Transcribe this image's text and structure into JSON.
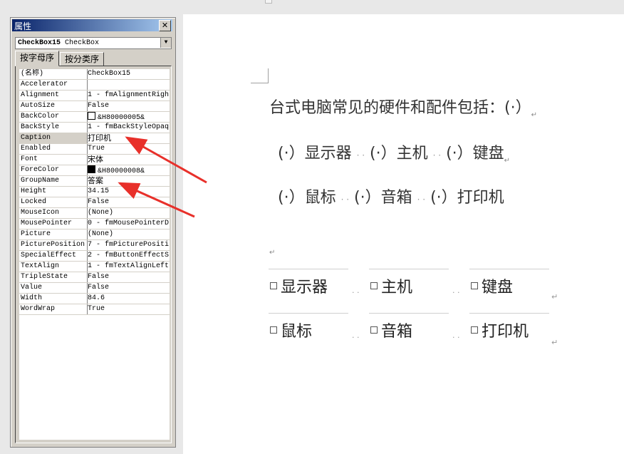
{
  "panel": {
    "title": "属性",
    "close": "✕",
    "object_selector": "CheckBox15 CheckBox",
    "tabs": [
      "按字母序",
      "按分类序"
    ],
    "properties": [
      {
        "name": "(名称)",
        "value": "CheckBox15"
      },
      {
        "name": "Accelerator",
        "value": ""
      },
      {
        "name": "Alignment",
        "value": "1 - fmAlignmentRigh"
      },
      {
        "name": "AutoSize",
        "value": "False"
      },
      {
        "name": "BackColor",
        "value": "&H80000005&"
      },
      {
        "name": "BackStyle",
        "value": "1 - fmBackStyleOpaq"
      },
      {
        "name": "Caption",
        "value": "打印机"
      },
      {
        "name": "Enabled",
        "value": "True"
      },
      {
        "name": "Font",
        "value": "宋体"
      },
      {
        "name": "ForeColor",
        "value": "&H80000008&"
      },
      {
        "name": "GroupName",
        "value": "答案"
      },
      {
        "name": "Height",
        "value": "34.15"
      },
      {
        "name": "Locked",
        "value": "False"
      },
      {
        "name": "MouseIcon",
        "value": "(None)"
      },
      {
        "name": "MousePointer",
        "value": "0 - fmMousePointerD"
      },
      {
        "name": "Picture",
        "value": "(None)"
      },
      {
        "name": "PicturePosition",
        "value": "7 - fmPicturePositi"
      },
      {
        "name": "SpecialEffect",
        "value": "2 - fmButtonEffectS"
      },
      {
        "name": "TextAlign",
        "value": "1 - fmTextAlignLeft"
      },
      {
        "name": "TripleState",
        "value": "False"
      },
      {
        "name": "Value",
        "value": "False"
      },
      {
        "name": "Width",
        "value": "84.6"
      },
      {
        "name": "WordWrap",
        "value": "True"
      }
    ],
    "colors": {
      "backcolor_swatch": "#ffffff",
      "forecolor_swatch": "#000000",
      "selected_row": "#d4d0c8"
    }
  },
  "doc": {
    "question": "台式电脑常见的硬件和配件包括：(·）",
    "line2": "(·）显示器",
    "line2b": "(·）主机",
    "line2c": "(·）键盘",
    "line3": "(·）鼠标",
    "line3b": "(·）音箱",
    "line3c": "(·）打印机",
    "checkboxes": [
      "显示器",
      "主机",
      "键盘",
      "鼠标",
      "音箱",
      "打印机"
    ],
    "paragraph_mark": "↵",
    "space_dots": "· ·"
  },
  "annotation": {
    "arrow_color": "#e8302a"
  }
}
